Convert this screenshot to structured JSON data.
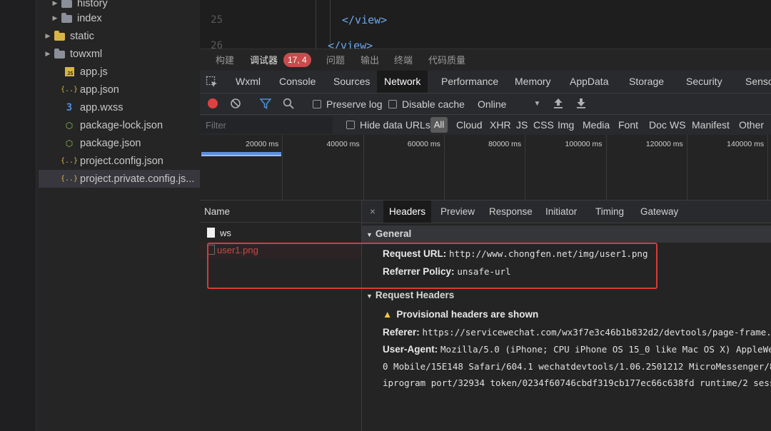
{
  "sidebar": {
    "items": [
      {
        "label": "history",
        "type": "folder",
        "color": "gray",
        "icon": "folder-icon"
      },
      {
        "label": "index",
        "type": "folder",
        "color": "gray",
        "icon": "folder-icon"
      },
      {
        "label": "static",
        "type": "folder",
        "color": "yellow",
        "icon": "folder-icon"
      },
      {
        "label": "towxml",
        "type": "folder",
        "color": "gray",
        "icon": "folder-icon"
      },
      {
        "label": "app.js",
        "type": "js",
        "icon": "js-file-icon"
      },
      {
        "label": "app.json",
        "type": "json",
        "icon": "json-file-icon"
      },
      {
        "label": "app.wxss",
        "type": "css",
        "icon": "css-file-icon"
      },
      {
        "label": "package-lock.json",
        "type": "node",
        "icon": "node-file-icon"
      },
      {
        "label": "package.json",
        "type": "node",
        "icon": "node-file-icon"
      },
      {
        "label": "project.config.json",
        "type": "json",
        "icon": "json-file-icon"
      },
      {
        "label": "project.private.config.js...",
        "type": "json",
        "icon": "json-file-icon",
        "selected": true
      }
    ]
  },
  "editor": {
    "lines": [
      {
        "number": "25",
        "code": "</view>"
      },
      {
        "number": "26",
        "code": "</view>"
      }
    ]
  },
  "panel_tabs": {
    "build": "构建",
    "debugger": "调试器",
    "badge": "17, 4",
    "issues": "问题",
    "output": "输出",
    "terminal": "终端",
    "code_quality": "代码质量"
  },
  "devtools_tabs": [
    "Wxml",
    "Console",
    "Sources",
    "Network",
    "Performance",
    "Memory",
    "AppData",
    "Storage",
    "Security",
    "Sensor"
  ],
  "devtools_active_tab": "Network",
  "toolbar": {
    "preserve_log": "Preserve log",
    "disable_cache": "Disable cache",
    "throttle": "Online"
  },
  "filter": {
    "placeholder": "Filter",
    "hide_data_urls": "Hide data URLs",
    "all": "All",
    "types": [
      "Cloud",
      "XHR",
      "JS",
      "CSS",
      "Img",
      "Media",
      "Font",
      "Doc",
      "WS",
      "Manifest",
      "Other"
    ]
  },
  "timeline": {
    "ticks": [
      "20000 ms",
      "40000 ms",
      "60000 ms",
      "80000 ms",
      "100000 ms",
      "120000 ms",
      "140000 ms"
    ]
  },
  "requests": {
    "header": "Name",
    "rows": [
      {
        "name": "ws",
        "status": "ok"
      },
      {
        "name": "user1.png",
        "status": "failed"
      }
    ]
  },
  "details": {
    "close": "×",
    "tabs": [
      "Headers",
      "Preview",
      "Response",
      "Initiator",
      "Timing",
      "Gateway"
    ],
    "active_tab": "Headers",
    "general": {
      "title": "General",
      "request_url_label": "Request URL:",
      "request_url": "http://www.chongfen.net/img/user1.png",
      "referrer_policy_label": "Referrer Policy:",
      "referrer_policy": "unsafe-url"
    },
    "request_headers": {
      "title": "Request Headers",
      "warning": "Provisional headers are shown",
      "referer_label": "Referer:",
      "referer": "https://servicewechat.com/wx3f7e3c46b1b832d2/devtools/page-frame.",
      "user_agent_label": "User-Agent:",
      "user_agent_1": "Mozilla/5.0 (iPhone; CPU iPhone OS 15_0 like Mac OS X) AppleWe",
      "user_agent_2": "0 Mobile/15E148 Safari/604.1 wechatdevtools/1.06.2501212 MicroMessenger/8",
      "user_agent_3": "iprogram port/32934 token/0234f60746cbdf319cb177ec66c638fd runtime/2 sess"
    }
  },
  "colors": {
    "accent_blue": "#5b8fdc",
    "record_red": "#e04040",
    "badge_red": "#c94c4c",
    "highlight_box": "#d93a3a",
    "failed_text": "#c84848"
  }
}
